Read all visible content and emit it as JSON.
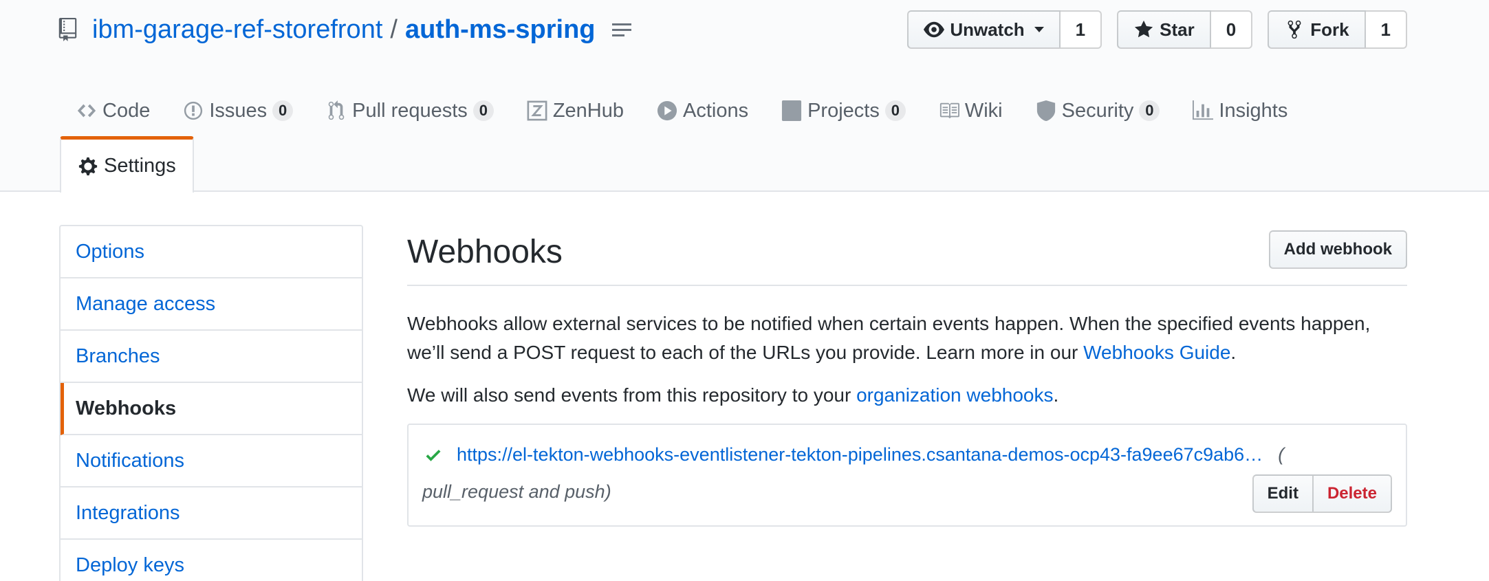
{
  "repo": {
    "owner": "ibm-garage-ref-storefront",
    "separator": "/",
    "name": "auth-ms-spring"
  },
  "actions": {
    "watch": {
      "label": "Unwatch",
      "count": "1"
    },
    "star": {
      "label": "Star",
      "count": "0"
    },
    "fork": {
      "label": "Fork",
      "count": "1"
    }
  },
  "tabs": [
    {
      "label": "Code",
      "icon": "code-icon"
    },
    {
      "label": "Issues",
      "count": "0",
      "icon": "issue-icon"
    },
    {
      "label": "Pull requests",
      "count": "0",
      "icon": "pull-request-icon"
    },
    {
      "label": "ZenHub",
      "icon": "zenhub-icon"
    },
    {
      "label": "Actions",
      "icon": "play-icon"
    },
    {
      "label": "Projects",
      "count": "0",
      "icon": "project-icon"
    },
    {
      "label": "Wiki",
      "icon": "book-icon"
    },
    {
      "label": "Security",
      "count": "0",
      "icon": "shield-icon"
    },
    {
      "label": "Insights",
      "icon": "graph-icon"
    },
    {
      "label": "Settings",
      "icon": "gear-icon",
      "selected": true
    }
  ],
  "sidebar": {
    "items": [
      {
        "label": "Options"
      },
      {
        "label": "Manage access"
      },
      {
        "label": "Branches"
      },
      {
        "label": "Webhooks",
        "selected": true
      },
      {
        "label": "Notifications"
      },
      {
        "label": "Integrations"
      },
      {
        "label": "Deploy keys"
      }
    ]
  },
  "webhooks": {
    "title": "Webhooks",
    "add_button": "Add webhook",
    "description_part1": "Webhooks allow external services to be notified when certain events happen. When the specified events happen, we’ll send a POST request to each of the URLs you provide. Learn more in our ",
    "guide_link": "Webhooks Guide",
    "description_end": ".",
    "org_part1": "We will also send events from this repository to your ",
    "org_link": "organization webhooks",
    "org_end": ".",
    "hooks": [
      {
        "status": "success",
        "url": "https://el-tekton-webhooks-eventlistener-tekton-pipelines.csantana-demos-ocp43-fa9ee67c9ab6…",
        "events_open": "(",
        "events": "pull_request and push)",
        "edit_label": "Edit",
        "delete_label": "Delete"
      }
    ]
  },
  "colors": {
    "link": "#0366d6",
    "accent": "#e36209",
    "success": "#28a745",
    "danger": "#cb2431"
  }
}
